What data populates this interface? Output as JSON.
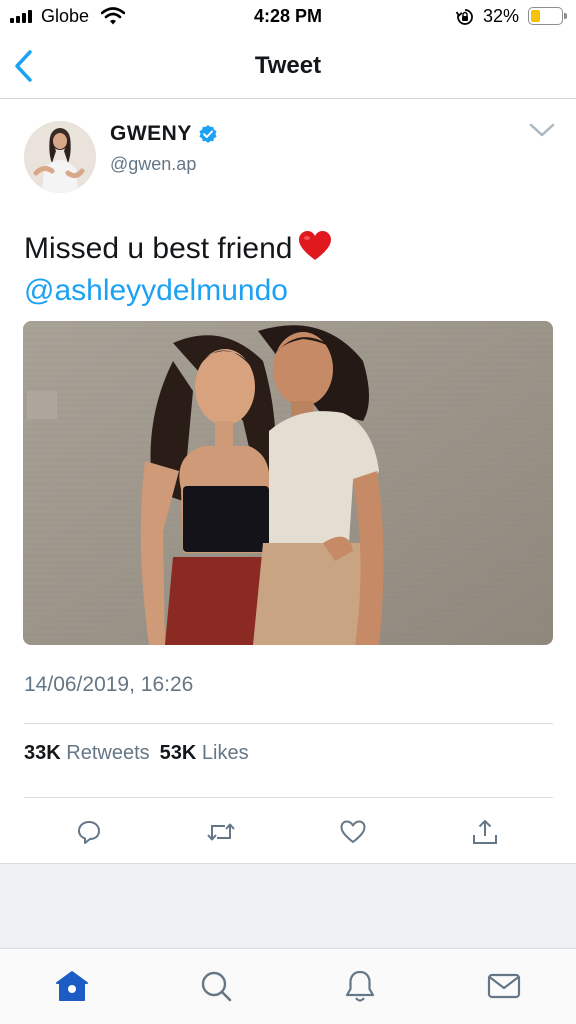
{
  "status_bar": {
    "carrier": "Globe",
    "time": "4:28 PM",
    "battery_percent": "32%",
    "battery_level": 0.32,
    "battery_color": "#f5c400"
  },
  "nav": {
    "title": "Tweet",
    "back_icon": "chevron-left-icon"
  },
  "tweet": {
    "display_name": "GWENY",
    "verified": true,
    "handle": "@gwen.ap",
    "text": "Missed u best friend",
    "emoji": "red-heart-icon",
    "mention": "@ashleyydelmundo",
    "timestamp": "14/06/2019, 16:26",
    "retweets_count": "33K",
    "retweets_label": "Retweets",
    "likes_count": "53K",
    "likes_label": "Likes"
  },
  "actions": [
    "reply-icon",
    "retweet-icon",
    "like-icon",
    "share-icon"
  ],
  "tabs": [
    {
      "name": "home",
      "icon": "home-icon",
      "active": true
    },
    {
      "name": "search",
      "icon": "search-icon",
      "active": false
    },
    {
      "name": "notifications",
      "icon": "bell-icon",
      "active": false
    },
    {
      "name": "messages",
      "icon": "mail-icon",
      "active": false
    }
  ],
  "colors": {
    "accent": "#1da1f2",
    "secondary_text": "#657786",
    "icon_gray": "#657786",
    "active_tab": "#1c5cc4"
  }
}
